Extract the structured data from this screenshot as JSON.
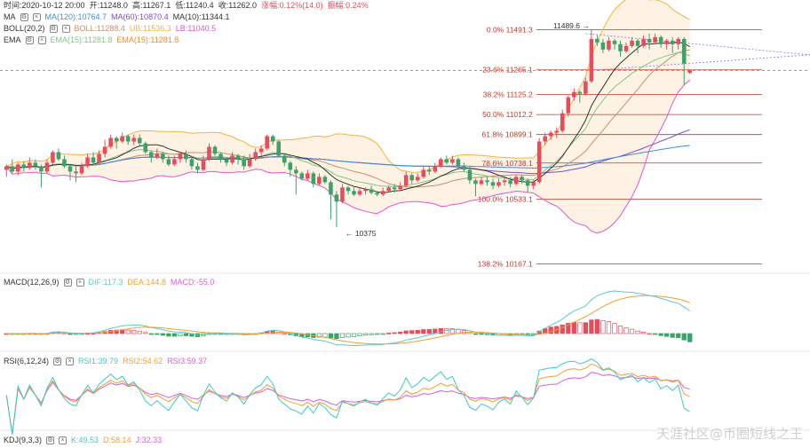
{
  "header": {
    "time": "时间:2020-10-12 20:00",
    "open": "开:11248.0",
    "high": "高:11267.1",
    "low": "低:11240.4",
    "close": "收:11262.0",
    "change": "涨幅:0.12%(14.0)",
    "amplitude": "振幅:0.24%"
  },
  "indicators": {
    "ma": {
      "label": "MA",
      "ma120": "MA(120):10764.7",
      "ma60": "MA(60):10870.4",
      "ma10": "MA(10):11344.1"
    },
    "boll": {
      "label": "BOLL(20,2)",
      "boll": "BOLL:11288.4",
      "ub": "UB:11536.3",
      "lb": "LB:11040.5"
    },
    "ema": {
      "label": "EMA",
      "ema15a": "EMA(15):11281.8",
      "ema15b": "EMA(15):11281.8"
    },
    "macd": {
      "label": "MACD(12,26,9)",
      "dif": "DIF:117.3",
      "dea": "DEA:144.8",
      "macd": "MACD:-55.0"
    },
    "rsi": {
      "label": "RSI(6,12,24)",
      "rsi1": "RSI1:39.79",
      "rsi2": "RSI2:54.62",
      "rsi3": "RSI3:59.37"
    },
    "kdj": {
      "label": "KDJ(9,3,3)",
      "k": "K:49.53",
      "d": "D:58.14",
      "j": "J:32.33"
    }
  },
  "colors": {
    "up": "#e84c5c",
    "down": "#3ea06a",
    "ma10": "#333333",
    "ma60": "#7c4dcc",
    "ma120": "#3e8fd8",
    "boll": "#c8906a",
    "ub": "#f5b335",
    "lb": "#e455c8",
    "ema": "#7ec97e",
    "fib": "#c0392b",
    "dif": "#5ec9c9",
    "dea": "#f0a030",
    "rsi1": "#3ec9c9",
    "rsi2": "#f0a030",
    "rsi3": "#d660d6"
  },
  "watermark": "天涯社区@币圈短线之王",
  "chart_data": {
    "type": "candlestick",
    "ylim": [
      10130,
      11660
    ],
    "fib_levels": [
      {
        "label": "0.0% 11491.3",
        "value": 11491.3
      },
      {
        "label": "23.6% 11265.1",
        "value": 11265.1
      },
      {
        "label": "38.2% 11125.2",
        "value": 11125.2
      },
      {
        "label": "50.0% 11012.2",
        "value": 11012.2
      },
      {
        "label": "61.8% 10899.1",
        "value": 10899.1
      },
      {
        "label": "78.6% 10738.1",
        "value": 10738.1
      },
      {
        "label": "100.0% 10533.1",
        "value": 10533.1
      },
      {
        "label": "138.2% 10167.1",
        "value": 10167.1
      }
    ],
    "annotations": [
      {
        "text": "11489.6",
        "value": 11489.6
      },
      {
        "text": "10375",
        "value": 10375
      }
    ],
    "candles": [
      [
        10700,
        10720,
        10660,
        10730
      ],
      [
        10720,
        10690,
        10680,
        10760
      ],
      [
        10690,
        10730,
        10670,
        10740
      ],
      [
        10730,
        10710,
        10690,
        10750
      ],
      [
        10710,
        10740,
        10700,
        10770
      ],
      [
        10740,
        10720,
        10700,
        10760
      ],
      [
        10720,
        10690,
        10600,
        10730
      ],
      [
        10690,
        10740,
        10680,
        10760
      ],
      [
        10740,
        10800,
        10730,
        10810
      ],
      [
        10800,
        10760,
        10750,
        10820
      ],
      [
        10760,
        10720,
        10710,
        10780
      ],
      [
        10720,
        10690,
        10640,
        10730
      ],
      [
        10690,
        10680,
        10630,
        10720
      ],
      [
        10680,
        10720,
        10670,
        10740
      ],
      [
        10720,
        10770,
        10710,
        10790
      ],
      [
        10770,
        10740,
        10730,
        10800
      ],
      [
        10740,
        10790,
        10730,
        10810
      ],
      [
        10790,
        10830,
        10770,
        10870
      ],
      [
        10830,
        10880,
        10820,
        10900
      ],
      [
        10880,
        10860,
        10820,
        10890
      ],
      [
        10860,
        10890,
        10850,
        10910
      ],
      [
        10890,
        10860,
        10840,
        10900
      ],
      [
        10860,
        10880,
        10840,
        10900
      ],
      [
        10880,
        10850,
        10830,
        10900
      ],
      [
        10850,
        10800,
        10790,
        10860
      ],
      [
        10800,
        10770,
        10740,
        10810
      ],
      [
        10770,
        10790,
        10760,
        10820
      ],
      [
        10790,
        10760,
        10740,
        10800
      ],
      [
        10760,
        10730,
        10720,
        10780
      ],
      [
        10730,
        10760,
        10720,
        10780
      ],
      [
        10760,
        10790,
        10740,
        10800
      ],
      [
        10790,
        10760,
        10740,
        10810
      ],
      [
        10760,
        10720,
        10700,
        10780
      ],
      [
        10720,
        10700,
        10680,
        10740
      ],
      [
        10700,
        10760,
        10690,
        10780
      ],
      [
        10760,
        10830,
        10750,
        10850
      ],
      [
        10830,
        10790,
        10780,
        10840
      ],
      [
        10790,
        10760,
        10740,
        10800
      ],
      [
        10760,
        10740,
        10720,
        10770
      ],
      [
        10740,
        10780,
        10730,
        10800
      ],
      [
        10780,
        10760,
        10730,
        10790
      ],
      [
        10760,
        10720,
        10700,
        10780
      ],
      [
        10720,
        10760,
        10710,
        10790
      ],
      [
        10760,
        10800,
        10750,
        10820
      ],
      [
        10800,
        10820,
        10780,
        10840
      ],
      [
        10820,
        10890,
        10810,
        10900
      ],
      [
        10890,
        10860,
        10840,
        10900
      ],
      [
        10860,
        10780,
        10770,
        10870
      ],
      [
        10780,
        10740,
        10720,
        10790
      ],
      [
        10740,
        10700,
        10660,
        10750
      ],
      [
        10700,
        10680,
        10560,
        10720
      ],
      [
        10680,
        10650,
        10640,
        10690
      ],
      [
        10650,
        10680,
        10640,
        10700
      ],
      [
        10680,
        10620,
        10600,
        10690
      ],
      [
        10620,
        10660,
        10610,
        10680
      ],
      [
        10660,
        10630,
        10620,
        10670
      ],
      [
        10630,
        10560,
        10420,
        10640
      ],
      [
        10560,
        10520,
        10375,
        10580
      ],
      [
        10520,
        10600,
        10510,
        10620
      ],
      [
        10600,
        10580,
        10560,
        10610
      ],
      [
        10580,
        10560,
        10550,
        10600
      ],
      [
        10560,
        10580,
        10550,
        10600
      ],
      [
        10580,
        10590,
        10560,
        10600
      ],
      [
        10590,
        10570,
        10560,
        10610
      ],
      [
        10570,
        10560,
        10550,
        10580
      ],
      [
        10560,
        10580,
        10550,
        10600
      ],
      [
        10580,
        10600,
        10570,
        10610
      ],
      [
        10600,
        10590,
        10570,
        10620
      ],
      [
        10590,
        10610,
        10580,
        10630
      ],
      [
        10610,
        10670,
        10600,
        10690
      ],
      [
        10670,
        10640,
        10620,
        10680
      ],
      [
        10640,
        10660,
        10630,
        10680
      ],
      [
        10660,
        10700,
        10650,
        10720
      ],
      [
        10700,
        10690,
        10670,
        10720
      ],
      [
        10690,
        10720,
        10680,
        10740
      ],
      [
        10720,
        10760,
        10710,
        10770
      ],
      [
        10760,
        10740,
        10730,
        10780
      ],
      [
        10740,
        10760,
        10730,
        10780
      ],
      [
        10760,
        10720,
        10700,
        10770
      ],
      [
        10720,
        10700,
        10690,
        10740
      ],
      [
        10700,
        10640,
        10620,
        10720
      ],
      [
        10640,
        10620,
        10550,
        10650
      ],
      [
        10620,
        10640,
        10610,
        10660
      ],
      [
        10640,
        10630,
        10610,
        10660
      ],
      [
        10630,
        10610,
        10590,
        10650
      ],
      [
        10610,
        10630,
        10600,
        10650
      ],
      [
        10630,
        10640,
        10610,
        10660
      ],
      [
        10640,
        10620,
        10600,
        10660
      ],
      [
        10620,
        10660,
        10610,
        10670
      ],
      [
        10660,
        10640,
        10620,
        10670
      ],
      [
        10640,
        10610,
        10570,
        10650
      ],
      [
        10610,
        10630,
        10590,
        10640
      ],
      [
        10630,
        10860,
        10620,
        10880
      ],
      [
        10860,
        10890,
        10840,
        10910
      ],
      [
        10890,
        10910,
        10870,
        10920
      ],
      [
        10910,
        10920,
        10880,
        10940
      ],
      [
        10920,
        11020,
        10910,
        11040
      ],
      [
        11020,
        11110,
        11000,
        11120
      ],
      [
        11110,
        11140,
        11090,
        11160
      ],
      [
        11140,
        11130,
        11080,
        11150
      ],
      [
        11130,
        11200,
        11120,
        11220
      ],
      [
        11200,
        11440,
        11190,
        11489.6
      ],
      [
        11440,
        11420,
        11400,
        11460
      ],
      [
        11420,
        11380,
        11360,
        11440
      ],
      [
        11380,
        11430,
        11370,
        11450
      ],
      [
        11430,
        11410,
        11380,
        11440
      ],
      [
        11410,
        11370,
        11340,
        11430
      ],
      [
        11370,
        11400,
        11360,
        11420
      ],
      [
        11400,
        11430,
        11390,
        11450
      ],
      [
        11430,
        11400,
        11360,
        11440
      ],
      [
        11400,
        11440,
        11390,
        11460
      ],
      [
        11440,
        11420,
        11380,
        11470
      ],
      [
        11420,
        11450,
        11410,
        11470
      ],
      [
        11450,
        11410,
        11390,
        11460
      ],
      [
        11410,
        11430,
        11380,
        11440
      ],
      [
        11430,
        11410,
        11360,
        11450
      ],
      [
        11410,
        11440,
        11380,
        11450
      ],
      [
        11440,
        11300,
        11180,
        11450
      ],
      [
        11248,
        11262,
        11240.4,
        11267.1
      ]
    ]
  }
}
